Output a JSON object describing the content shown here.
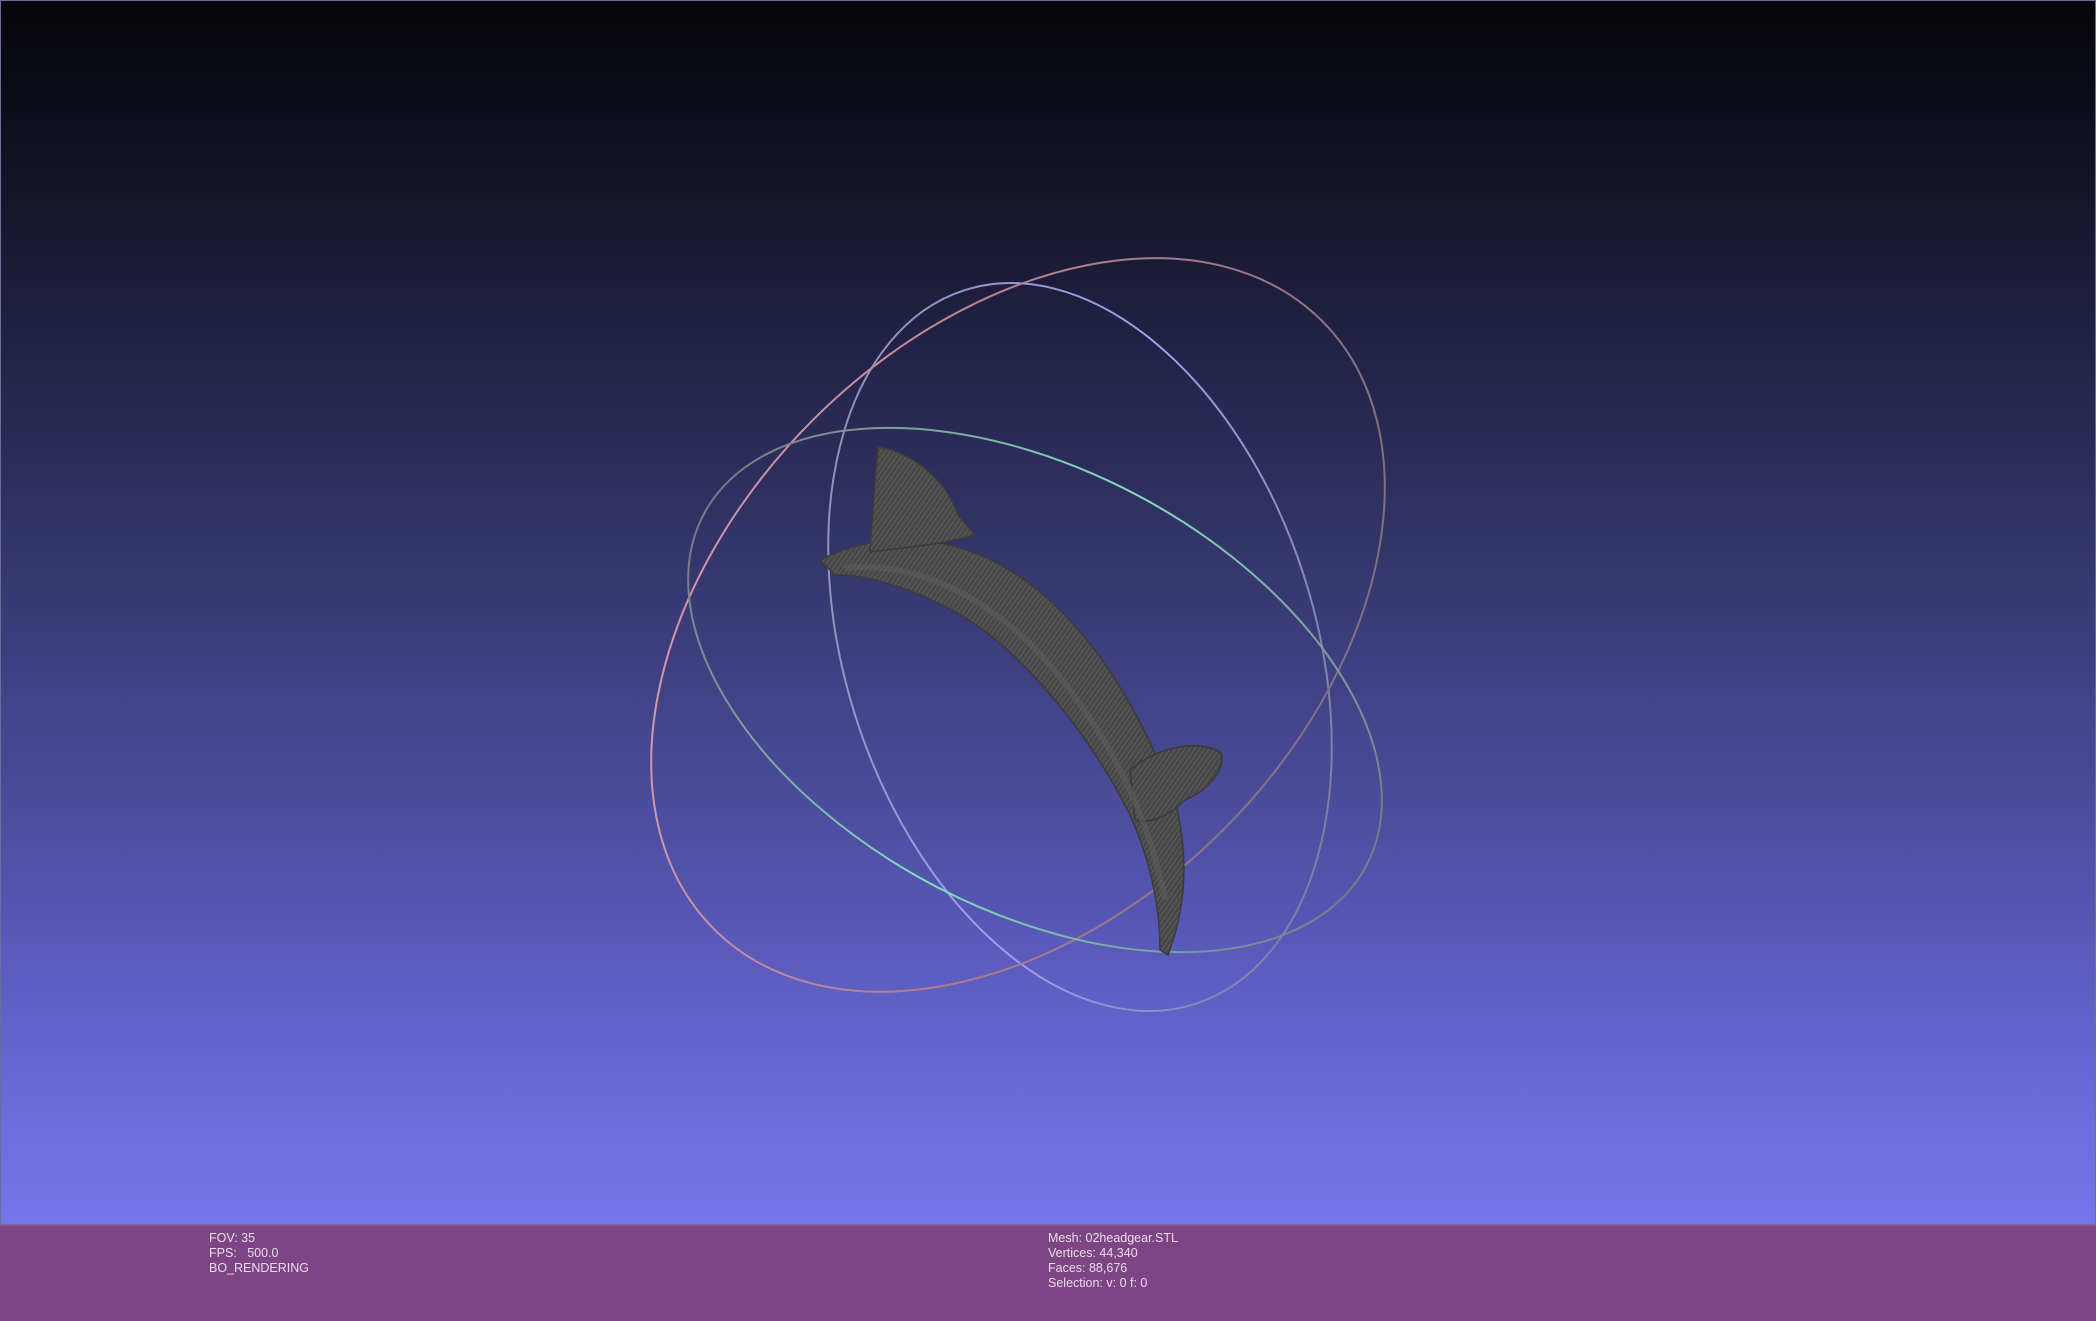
{
  "viewer": {
    "colors": {
      "background_top": "#050508",
      "background_bottom": "#7576ea",
      "info_bar": "#7e4584",
      "mesh": "#484848",
      "trackball_ring_x": "#d8a0b0",
      "trackball_ring_y": "#a0a0f0",
      "trackball_ring_z": "#80e0c0"
    },
    "scene": {
      "mesh_icon": "headgear-mesh-wireframe",
      "trackball_icon": "trackball-gizmo"
    }
  },
  "info_left": {
    "fov": "FOV: 35",
    "fps": "FPS:   500.0",
    "rendering": "BO_RENDERING"
  },
  "info_right": {
    "mesh": "Mesh: 02headgear.STL",
    "vertices": "Vertices: 44,340",
    "faces": "Faces: 88,676",
    "selection": "Selection: v: 0 f: 0"
  }
}
